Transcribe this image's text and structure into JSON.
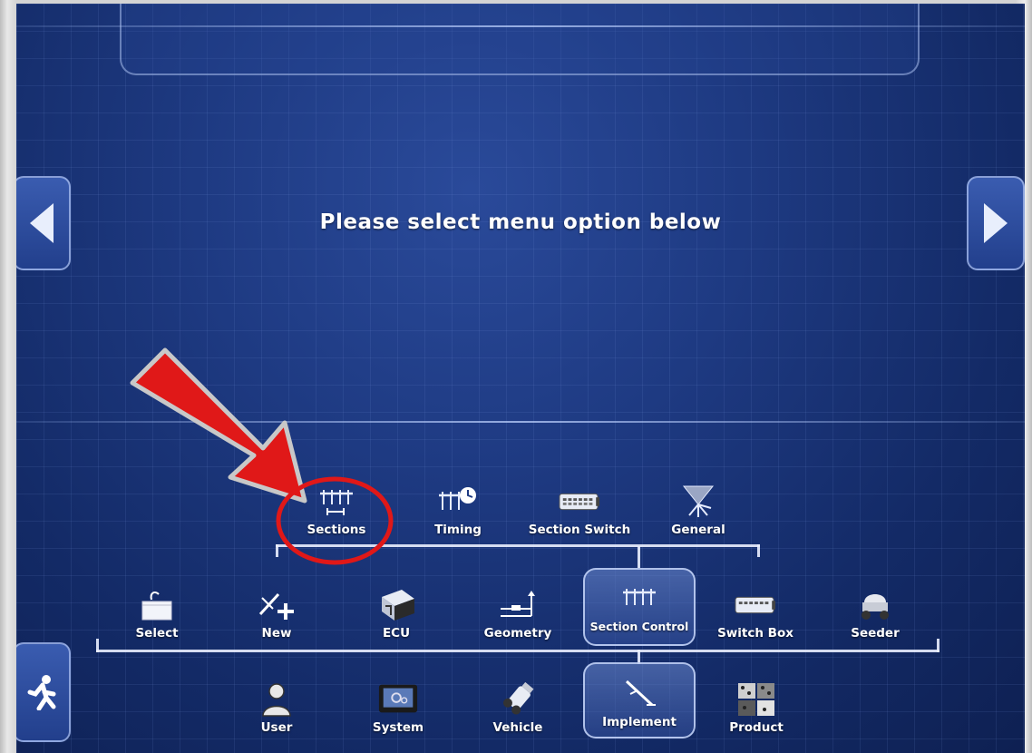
{
  "screen": {
    "message": "Please select menu option below"
  },
  "nav": {
    "prev_icon": "arrow-left-icon",
    "next_icon": "arrow-right-icon",
    "exit_icon": "running-man-exit-icon"
  },
  "submenu_row": [
    {
      "label": "Sections",
      "icon": "sections-boom-icon"
    },
    {
      "label": "Timing",
      "icon": "timing-clock-icon"
    },
    {
      "label": "Section Switch",
      "icon": "section-switch-icon"
    },
    {
      "label": "General",
      "icon": "general-spray-icon"
    }
  ],
  "implement_row": [
    {
      "label": "Select",
      "icon": "select-basket-icon"
    },
    {
      "label": "New",
      "icon": "new-implement-icon"
    },
    {
      "label": "ECU",
      "icon": "ecu-box-icon"
    },
    {
      "label": "Geometry",
      "icon": "geometry-icon"
    },
    {
      "label": "Section Control",
      "icon": "section-control-icon",
      "active": true
    },
    {
      "label": "Switch Box",
      "icon": "switch-box-icon"
    },
    {
      "label": "Seeder",
      "icon": "seeder-icon"
    }
  ],
  "main_row": [
    {
      "label": "User",
      "icon": "user-icon"
    },
    {
      "label": "System",
      "icon": "system-monitor-icon"
    },
    {
      "label": "Vehicle",
      "icon": "vehicle-icon"
    },
    {
      "label": "Implement",
      "icon": "implement-icon",
      "active": true
    },
    {
      "label": "Product",
      "icon": "product-icon"
    }
  ],
  "colors": {
    "background": "#1e3a82",
    "annotation_red": "#e01818"
  }
}
